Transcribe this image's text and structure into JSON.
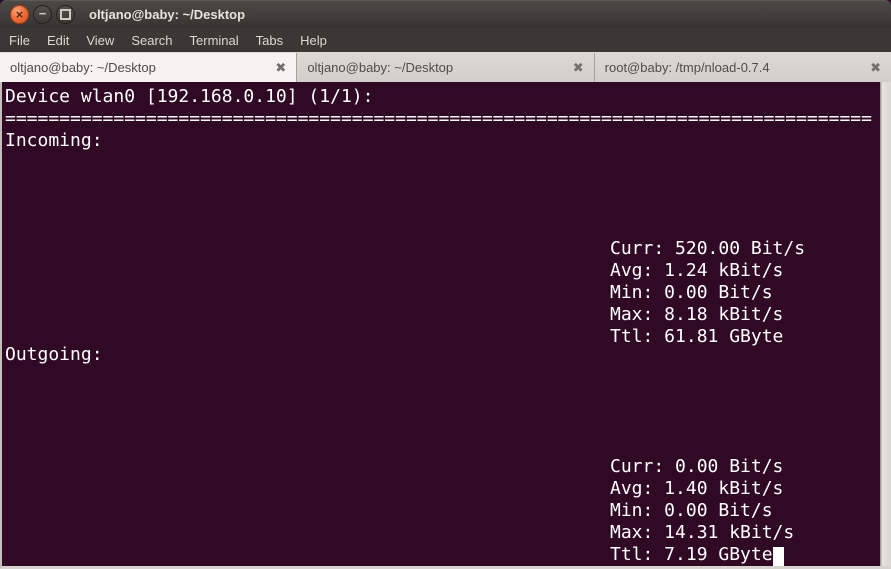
{
  "window": {
    "title": "oltjano@baby: ~/Desktop",
    "icons": {
      "close": "×",
      "minimize": "−",
      "tab_close": "✖"
    }
  },
  "menubar": {
    "items": [
      "File",
      "Edit",
      "View",
      "Search",
      "Terminal",
      "Tabs",
      "Help"
    ]
  },
  "tabs": [
    {
      "label": "oltjano@baby: ~/Desktop",
      "active": true
    },
    {
      "label": "oltjano@baby: ~/Desktop",
      "active": false
    },
    {
      "label": "root@baby: /tmp/nload-0.7.4",
      "active": false
    }
  ],
  "terminal": {
    "colors": {
      "background": "#300a24",
      "text": "#ffffff"
    },
    "device_line": "Device wlan0 [192.168.0.10] (1/1):",
    "separator": "================================================================================",
    "incoming": {
      "label": "Incoming:",
      "stats": [
        "Curr: 520.00 Bit/s",
        "Avg: 1.24 kBit/s",
        "Min: 0.00 Bit/s",
        "Max: 8.18 kBit/s",
        "Ttl: 61.81 GByte"
      ]
    },
    "outgoing": {
      "label": "Outgoing:",
      "stats": [
        "Curr: 0.00 Bit/s",
        "Avg: 1.40 kBit/s",
        "Min: 0.00 Bit/s",
        "Max: 14.31 kBit/s",
        "Ttl: 7.19 GByte"
      ]
    }
  }
}
